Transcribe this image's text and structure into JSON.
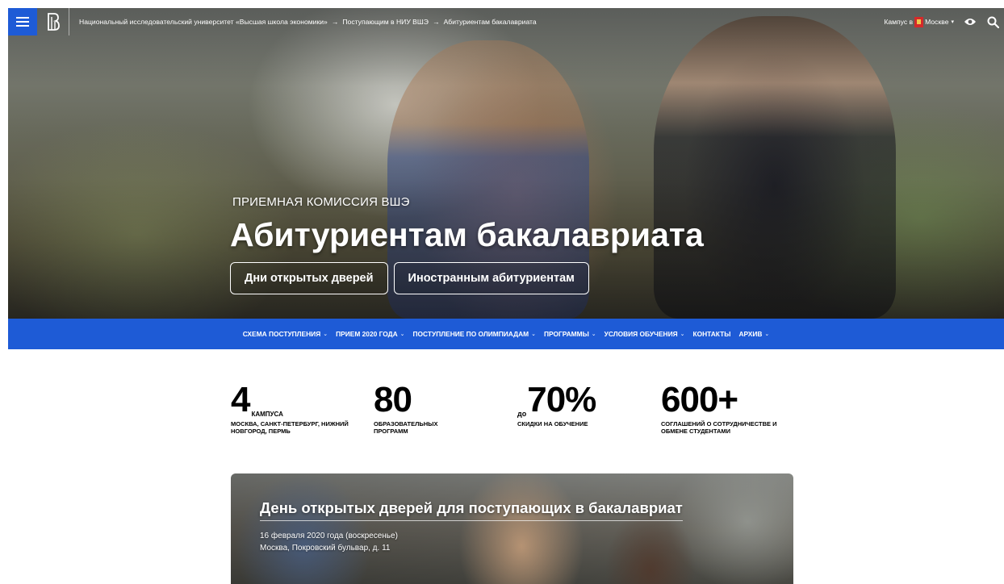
{
  "colors": {
    "brand_blue": "#1e5bd6",
    "text_dark": "#000000",
    "hero_text": "#ffffff"
  },
  "topbar": {
    "breadcrumb": [
      "Национальный исследовательский университет «Высшая школа экономики»",
      "Поступающим в НИУ ВШЭ",
      "Абитуриентам бакалавриата"
    ],
    "separator": "→",
    "campus_label": "Кампус в",
    "campus_city": "Москве",
    "icons": [
      "menu-icon",
      "hse-logo",
      "flag-icon",
      "eye-icon",
      "search-icon"
    ]
  },
  "hero": {
    "kicker": "ПРИЕМНАЯ КОМИССИЯ ВШЭ",
    "title": "Абитуриентам бакалавриата",
    "buttons": [
      "Дни открытых дверей",
      "Иностранным абитуриентам"
    ]
  },
  "subnav": {
    "items": [
      {
        "label": "СХЕМА ПОСТУПЛЕНИЯ",
        "dropdown": true
      },
      {
        "label": "ПРИЕМ 2020 ГОДА",
        "dropdown": true
      },
      {
        "label": "ПОСТУПЛЕНИЕ ПО ОЛИМПИАДАМ",
        "dropdown": true
      },
      {
        "label": "ПРОГРАММЫ",
        "dropdown": true
      },
      {
        "label": "УСЛОВИЯ ОБУЧЕНИЯ",
        "dropdown": true
      },
      {
        "label": "КОНТАКТЫ",
        "dropdown": false
      },
      {
        "label": "АРХИВ",
        "dropdown": true
      }
    ],
    "chevron": "⌄"
  },
  "stats": [
    {
      "prefix": "",
      "value": "4",
      "unit": "КАМПУСА",
      "desc": "МОСКВА, САНКТ-ПЕТЕРБУРГ, НИЖНИЙ НОВГОРОД, ПЕРМЬ"
    },
    {
      "prefix": "",
      "value": "80",
      "unit": "",
      "desc": "ОБРАЗОВАТЕЛЬНЫХ ПРОГРАММ"
    },
    {
      "prefix": "до",
      "value": "70%",
      "unit": "",
      "desc": "СКИДКИ НА ОБУЧЕНИЕ"
    },
    {
      "prefix": "",
      "value": "600+",
      "unit": "",
      "desc": "СОГЛАШЕНИЙ О СОТРУДНИЧЕСТВЕ И ОБМЕНЕ СТУДЕНТАМИ"
    }
  ],
  "promo": {
    "title": "День открытых дверей для поступающих в бакалавриат",
    "date": "16 февраля 2020 года (воскресенье)",
    "place": "Москва, Покровский бульвар, д. 11"
  }
}
